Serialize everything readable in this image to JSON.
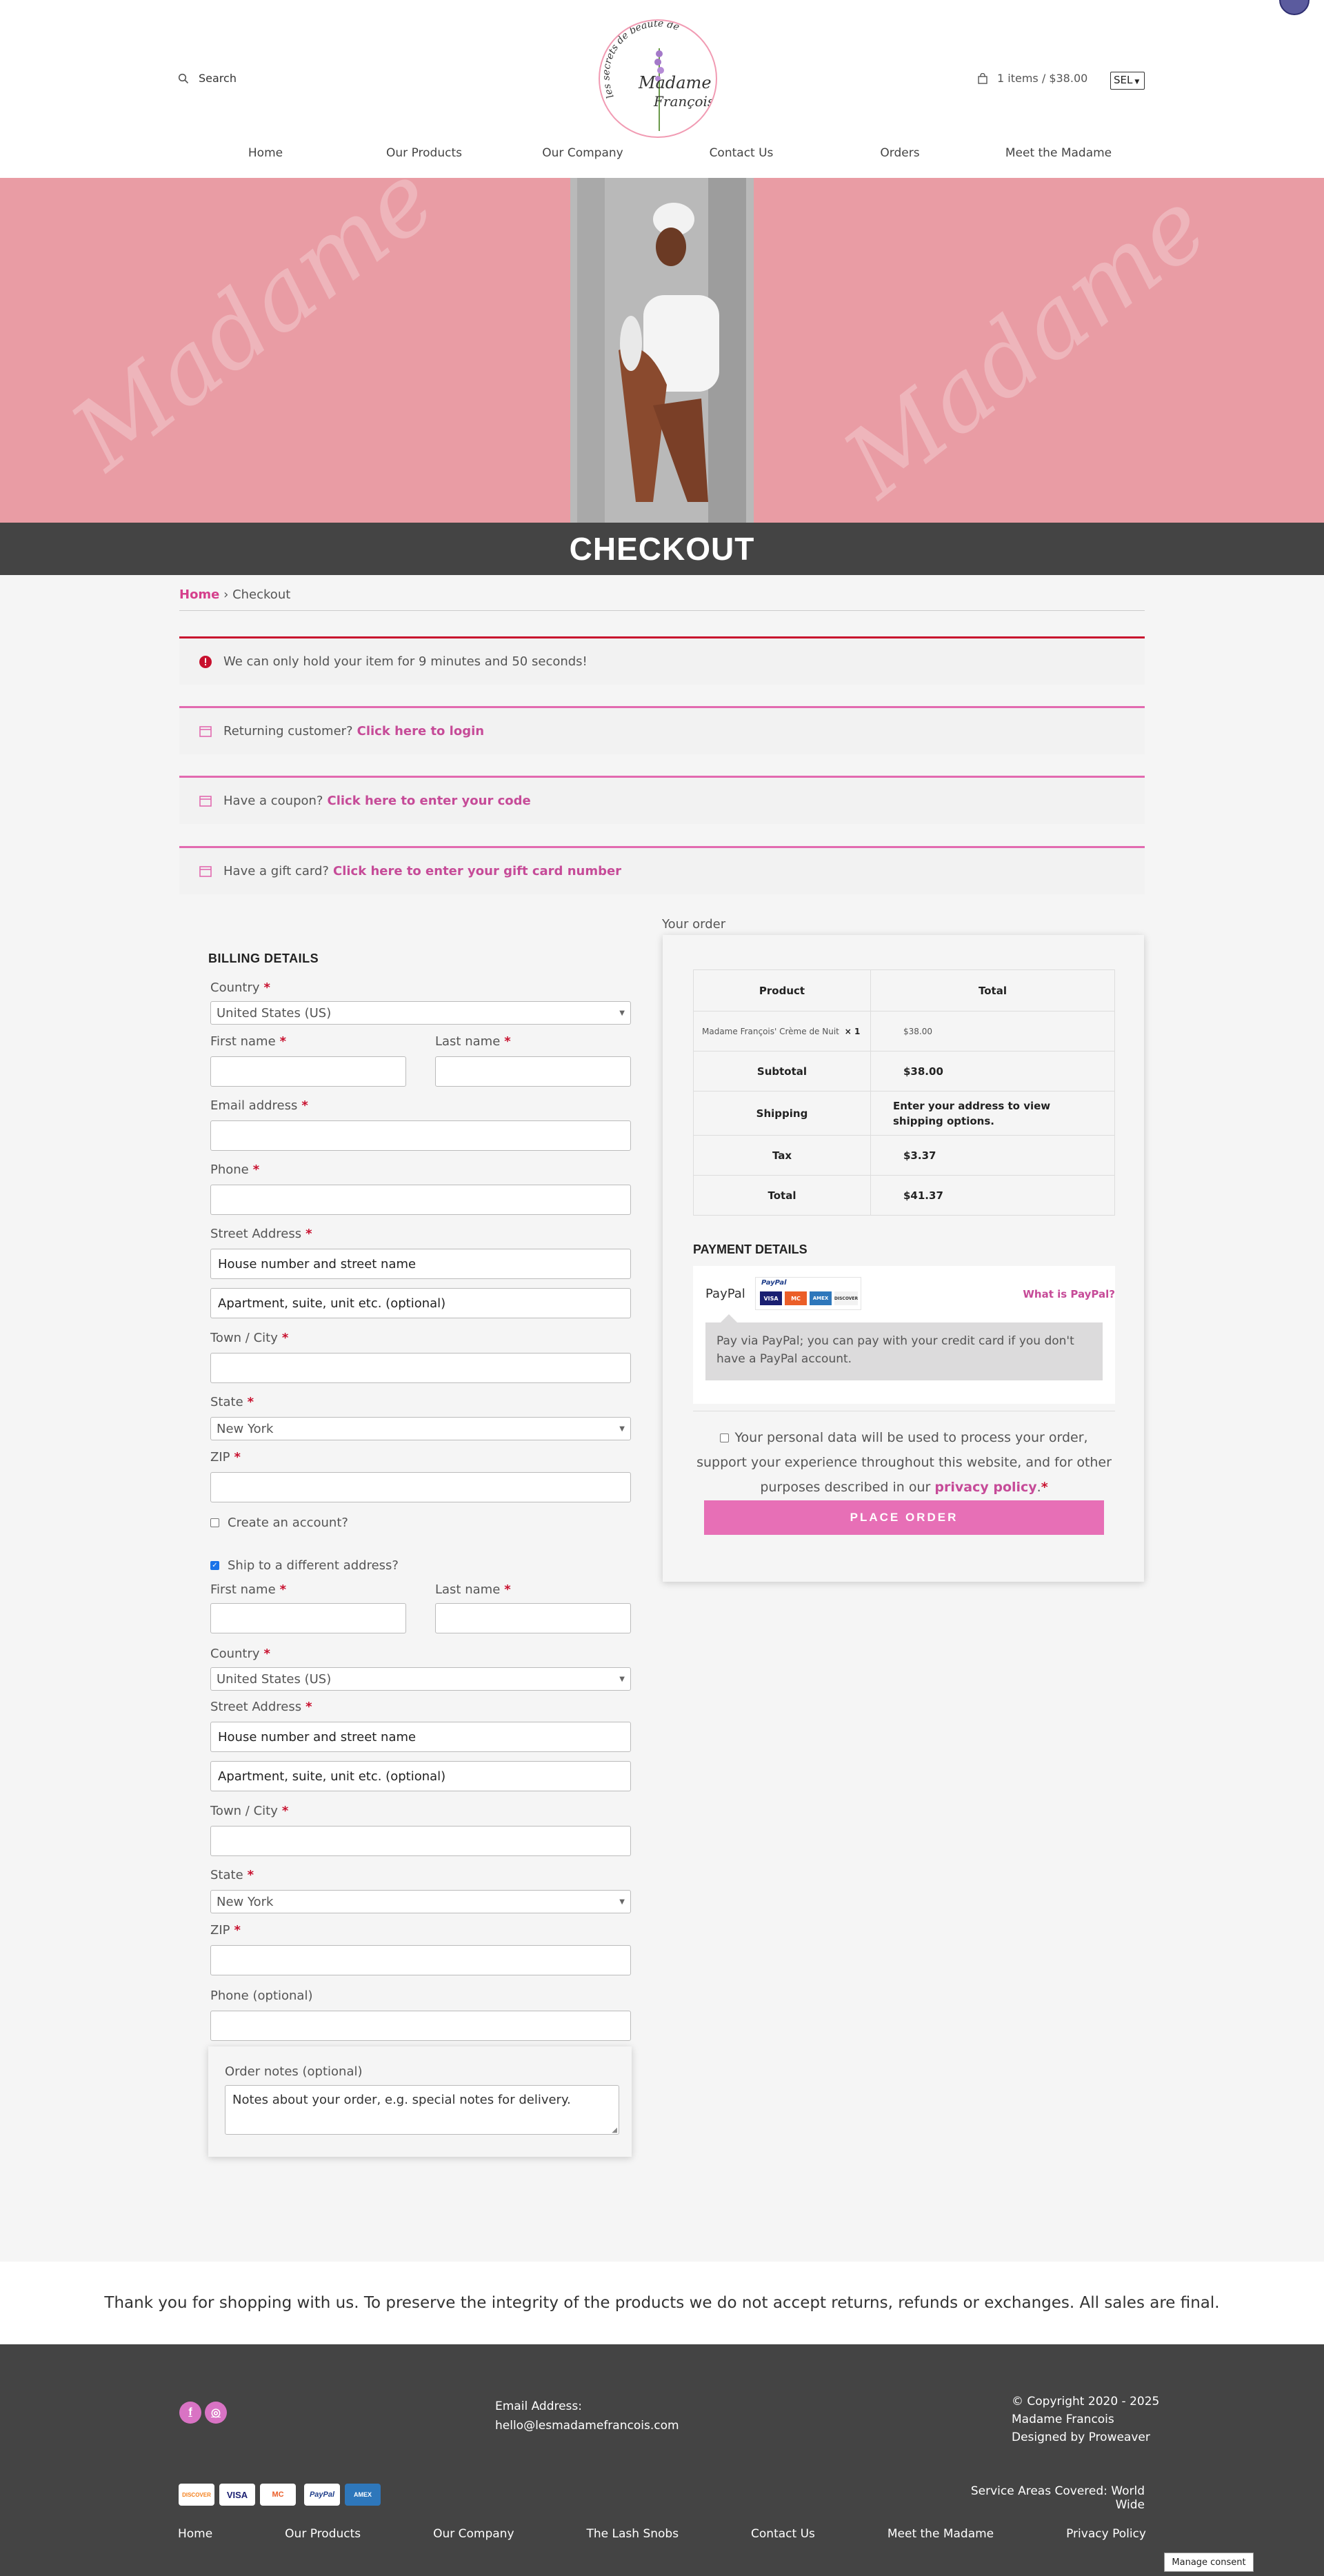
{
  "header": {
    "search_label": "Search",
    "logo_top_text": "les secrets de beauté de",
    "logo_name_line1": "Madame",
    "logo_name_line2": "François",
    "cart_label": "1 items / $38.00",
    "currency": "SEL"
  },
  "nav": [
    "Home",
    "Our Products",
    "Our Company",
    "Contact Us",
    "Orders",
    "Meet the Madame"
  ],
  "hero": {
    "watermark": "Madame",
    "page_title": "CHECKOUT"
  },
  "breadcrumb": {
    "home": "Home",
    "separator": "›",
    "current": "Checkout"
  },
  "notices": {
    "hold": "We can only hold your item for 9 minutes and 50 seconds!",
    "returning_text": "Returning customer?",
    "returning_link": "Click here to login",
    "coupon_text": "Have a coupon?",
    "coupon_link": "Click here to enter your code",
    "gift_text": "Have a gift card?",
    "gift_link": "Click here to enter your gift card number"
  },
  "billing": {
    "title": "BILLING DETAILS",
    "country_label": "Country",
    "country_value": "United States (US)",
    "first_name_label": "First name",
    "last_name_label": "Last name",
    "email_label": "Email address",
    "phone_label": "Phone",
    "street_label": "Street Address",
    "street_placeholder1": "House number and street name",
    "street_placeholder2": "Apartment, suite, unit etc. (optional)",
    "city_label": "Town / City",
    "state_label": "State",
    "state_value": "New York",
    "zip_label": "ZIP",
    "create_account_label": "Create an account?",
    "ship_different_label": "Ship to a different address?",
    "required_mark": "*"
  },
  "shipping": {
    "first_name_label": "First name",
    "last_name_label": "Last name",
    "country_label": "Country",
    "country_value": "United States (US)",
    "street_label": "Street Address",
    "street_placeholder1": "House number and street name",
    "street_placeholder2": "Apartment, suite, unit etc. (optional)",
    "city_label": "Town / City",
    "state_label": "State",
    "state_value": "New York",
    "zip_label": "ZIP",
    "phone_label": "Phone (optional)",
    "notes_label": "Order notes (optional)",
    "notes_placeholder": "Notes about your order, e.g. special notes for delivery."
  },
  "order": {
    "label": "Your order",
    "col_product": "Product",
    "col_total": "Total",
    "item_name": "Madame François' Crème de Nuit",
    "item_qty": "× 1",
    "item_total": "$38.00",
    "subtotal_label": "Subtotal",
    "subtotal_value": "$38.00",
    "shipping_label": "Shipping",
    "shipping_value": "Enter your address to view shipping options.",
    "tax_label": "Tax",
    "tax_value": "$3.37",
    "total_label": "Total",
    "total_value": "$41.37"
  },
  "payment": {
    "title": "PAYMENT DETAILS",
    "method": "PayPal",
    "paypal_logo_text": "PayPal",
    "what_is": "What is PayPal?",
    "description": "Pay via PayPal; you can pay with your credit card if you don't have a PayPal account.",
    "privacy_text": "Your personal data will be used to process your order, support your experience throughout this website, and for other purposes described in our",
    "privacy_link": "privacy policy",
    "privacy_end": ".",
    "place_order": "PLACE ORDER",
    "card_brands": [
      "VISA",
      "MC",
      "AMEX",
      "DISCOVER"
    ]
  },
  "thankyou": "Thank you for shopping with us. To preserve the integrity of the products we do not accept returns, refunds or exchanges. All sales are final.",
  "footer": {
    "email_label": "Email Address:",
    "email": "hello@lesmadamefrancois.com",
    "copyright": "© Copyright 2020 - 2025",
    "company": "Madame Francois",
    "designed_by": "Designed by Proweaver",
    "service_areas": "Service Areas Covered: World Wide",
    "social": [
      "f",
      "◎"
    ],
    "card_logos": [
      "DISCOVER",
      "VISA",
      "MC",
      "PayPal",
      "AMEX"
    ],
    "nav": [
      "Home",
      "Our Products",
      "Our Company",
      "The Lash Snobs",
      "Contact Us",
      "Meet the Madame",
      "Privacy Policy"
    ],
    "consent": "Manage consent"
  },
  "colors": {
    "accent": "#e26ab0",
    "link": "#c64b98",
    "error": "#c8102e",
    "hero": "#e99ca4",
    "dark": "#444444"
  }
}
